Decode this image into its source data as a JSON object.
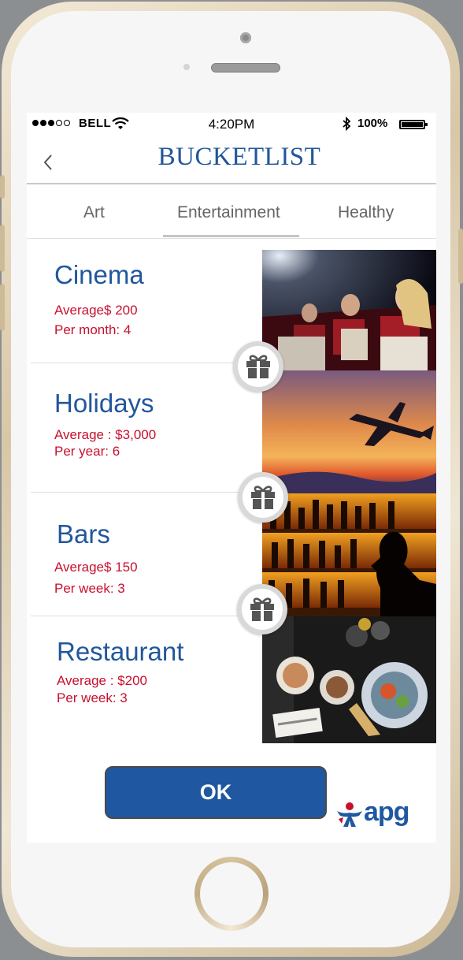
{
  "status_bar": {
    "carrier": "BELL",
    "time": "4:20PM",
    "bluetooth_icon": "bluetooth-icon",
    "battery_percent": "100%"
  },
  "header": {
    "back_label": "<",
    "title": "BUCKETLIST"
  },
  "tabs": [
    {
      "label": "Art",
      "selected": false
    },
    {
      "label": "Entertainment",
      "selected": true
    },
    {
      "label": "Healthy",
      "selected": false
    }
  ],
  "items": [
    {
      "title": "Cinema",
      "line1": "Average$ 200",
      "line2": "Per month: 4",
      "image": "cinema-audience-image"
    },
    {
      "title": "Holidays",
      "line1": "Average : $3,000",
      "line2": "Per year: 6",
      "image": "airplane-sunset-image"
    },
    {
      "title": "Bars",
      "line1": "Average$ 150",
      "line2": "Per week: 3",
      "image": "bar-silhouette-image"
    },
    {
      "title": "Restaurant",
      "line1": "Average : $200",
      "line2": "Per week: 3",
      "image": "restaurant-table-image"
    }
  ],
  "gift_icon": "gift-icon",
  "ok_button": {
    "label": "OK"
  },
  "logo": {
    "text": "apg"
  },
  "colors": {
    "brand_blue": "#1f58a1",
    "accent_red": "#c8102e"
  }
}
